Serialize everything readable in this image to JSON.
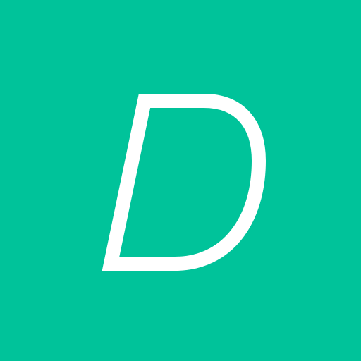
{
  "app_icon": {
    "letter": "D",
    "background_color": "#00c39a",
    "letter_color": "#ffffff"
  }
}
